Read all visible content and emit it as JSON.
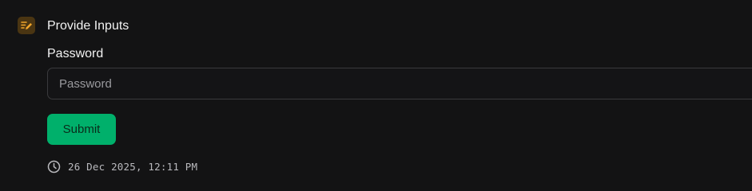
{
  "form": {
    "header": {
      "title": "Provide Inputs",
      "icon": "edit-form-icon",
      "icon_color": "#f0a52b"
    },
    "password_field": {
      "label": "Password",
      "placeholder": "Password",
      "value": ""
    },
    "submit_label": "Submit",
    "submit_color": "#00b06b",
    "timestamp": "26 Dec 2025, 12:11 PM",
    "timestamp_icon": "clock-icon"
  }
}
